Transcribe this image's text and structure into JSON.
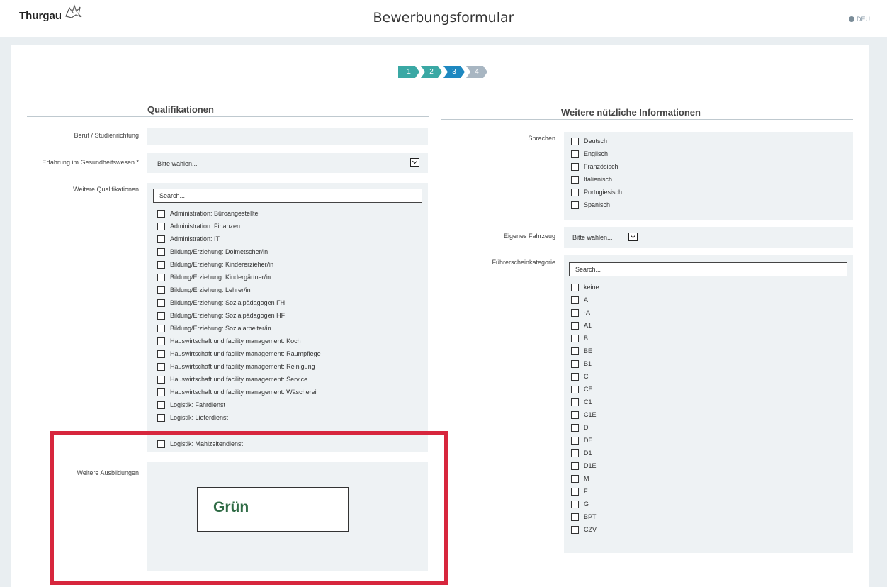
{
  "header": {
    "logo_text": "Thurgau",
    "title": "Bewerbungsformular",
    "language": "DEU"
  },
  "stepper": {
    "steps": [
      "1",
      "2",
      "3",
      "4"
    ],
    "current_step": 3
  },
  "left": {
    "section_title": "Qualifikationen",
    "beruf_label": "Beruf / Studienrichtung",
    "erfahrung_label": "Erfahrung im Gesundheitswesen *",
    "erfahrung_value": "Bitte wahlen...",
    "weitere_quali_label": "Weitere Qualifikationen",
    "search_placeholder": "Search...",
    "qualifications": [
      "Administration: Büroangestellte",
      "Administration: Finanzen",
      "Administration: IT",
      "Bildung/Erziehung: Dolmetscher/in",
      "Bildung/Erziehung: Kindererzieher/in",
      "Bildung/Erziehung: Kindergärtner/in",
      "Bildung/Erziehung: Lehrer/in",
      "Bildung/Erziehung: Sozialpädagogen FH",
      "Bildung/Erziehung: Sozialpädagogen HF",
      "Bildung/Erziehung: Sozialarbeiter/in",
      "Hauswirtschaft und facility management: Koch",
      "Hauswirtschaft und facility management: Raumpflege",
      "Hauswirtschaft und facility management: Reinigung",
      "Hauswirtschaft und facility management: Service",
      "Hauswirtschaft und facility management: Wäscherei",
      "Logistik: Fahrdienst",
      "Logistik: Lieferdienst"
    ],
    "last_qualification": "Logistik: Mahlzeitendienst",
    "ausbildungen_label": "Weitere Ausbildungen"
  },
  "right": {
    "section_title": "Weitere nützliche Informationen",
    "sprachen_label": "Sprachen",
    "languages": [
      "Deutsch",
      "Englisch",
      "Französisch",
      "Italienisch",
      "Portugiesisch",
      "Spanisch"
    ],
    "fahrzeug_label": "Eigenes Fahrzeug",
    "fahrzeug_value": "Bitte wahlen...",
    "fuehrerschein_label": "Führerscheinkategorie",
    "search_placeholder": "Search...",
    "licenses": [
      "keine",
      "A",
      "-A",
      "A1",
      "B",
      "BE",
      "B1",
      "C",
      "CE",
      "C1",
      "C1E",
      "D",
      "DE",
      "D1",
      "D1E",
      "M",
      "F",
      "G",
      "BPT",
      "CZV"
    ]
  },
  "annotation": {
    "text": "Grün",
    "border_color": "#d7263d",
    "text_color": "#2f6b45"
  }
}
